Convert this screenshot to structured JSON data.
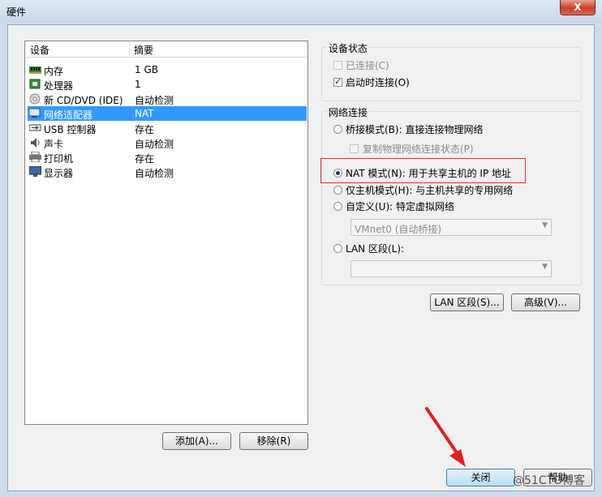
{
  "window": {
    "title": "硬件",
    "close_glyph": "X"
  },
  "device_list": {
    "col_device": "设备",
    "col_summary": "摘要",
    "rows": [
      {
        "name": "内存",
        "summary": "1 GB",
        "icon": "memory-icon"
      },
      {
        "name": "处理器",
        "summary": "1",
        "icon": "processor-icon"
      },
      {
        "name": "新 CD/DVD (IDE)",
        "summary": "自动检测",
        "icon": "cd-dvd-icon"
      },
      {
        "name": "网络适配器",
        "summary": "NAT",
        "icon": "network-adapter-icon",
        "selected": true
      },
      {
        "name": "USB 控制器",
        "summary": "存在",
        "icon": "usb-icon"
      },
      {
        "name": "声卡",
        "summary": "自动检测",
        "icon": "sound-card-icon"
      },
      {
        "name": "打印机",
        "summary": "存在",
        "icon": "printer-icon"
      },
      {
        "name": "显示器",
        "summary": "自动检测",
        "icon": "display-icon"
      }
    ]
  },
  "buttons": {
    "add": "添加(A)...",
    "remove": "移除(R)",
    "lan_segments": "LAN 区段(S)...",
    "advanced": "高级(V)...",
    "close": "关闭",
    "help": "帮助"
  },
  "device_status": {
    "legend": "设备状态",
    "connected": "已连接(C)",
    "connect_on_power": "启动时连接(O)",
    "connected_checked": false,
    "connect_on_power_checked": true
  },
  "network": {
    "legend": "网络连接",
    "bridged": "桥接模式(B): 直接连接物理网络",
    "replicate": "复制物理网络连接状态(P)",
    "nat": "NAT 模式(N): 用于共享主机的 IP 地址",
    "host_only": "仅主机模式(H): 与主机共享的专用网络",
    "custom": "自定义(U): 特定虚拟网络",
    "custom_value": "VMnet0 (自动桥接)",
    "lan": "LAN 区段(L):",
    "lan_value": "",
    "selected": "nat"
  },
  "watermark": "@51CTO博客",
  "colors": {
    "selection": "#3399ff",
    "highlight_box": "#e03030",
    "annotation_arrow": "#e02020"
  }
}
